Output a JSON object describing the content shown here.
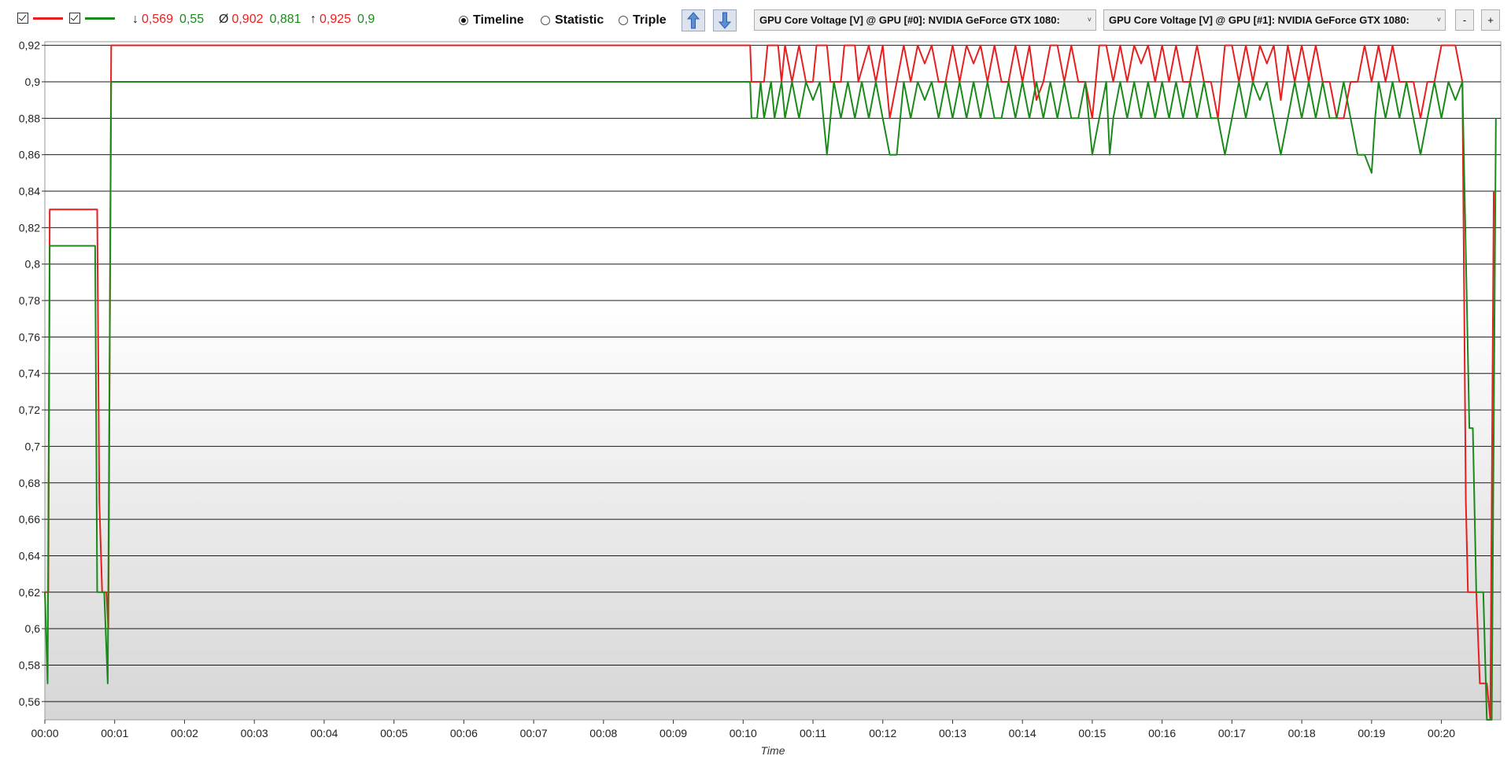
{
  "toolbar": {
    "series_a": {
      "checked": true,
      "color": "#e81f1f"
    },
    "series_b": {
      "checked": true,
      "color": "#1a8a1a"
    },
    "stats": {
      "min_symbol": "↓",
      "min_a": "0,569",
      "min_b": "0,55",
      "avg_symbol": "Ø",
      "avg_a": "0,902",
      "avg_b": "0,881",
      "max_symbol": "↑",
      "max_a": "0,925",
      "max_b": "0,9"
    },
    "modes": [
      {
        "label": "Timeline",
        "selected": true
      },
      {
        "label": "Statistic",
        "selected": false
      },
      {
        "label": "Triple",
        "selected": false
      }
    ],
    "up_icon": "arrow-up-icon",
    "down_icon": "arrow-down-icon",
    "sensor_1": "GPU Core Voltage [V] @ GPU [#0]: NVIDIA GeForce GTX 1080:",
    "sensor_2": "GPU Core Voltage [V] @ GPU [#1]: NVIDIA GeForce GTX 1080:",
    "minus_label": "-",
    "plus_label": "+"
  },
  "chart_data": {
    "type": "line",
    "xlabel": "Time",
    "ylabel": "",
    "ylim": [
      0.55,
      0.922
    ],
    "y_ticks": [
      "0,56",
      "0,58",
      "0,6",
      "0,62",
      "0,64",
      "0,66",
      "0,68",
      "0,7",
      "0,72",
      "0,74",
      "0,76",
      "0,78",
      "0,8",
      "0,82",
      "0,84",
      "0,86",
      "0,88",
      "0,9",
      "0,92"
    ],
    "x_ticks": [
      "00:00",
      "00:01",
      "00:02",
      "00:03",
      "00:04",
      "00:05",
      "00:06",
      "00:07",
      "00:08",
      "00:09",
      "00:10",
      "00:11",
      "00:12",
      "00:13",
      "00:14",
      "00:15",
      "00:16",
      "00:17",
      "00:18",
      "00:19",
      "00:20"
    ],
    "xlim_minutes": [
      0,
      20.85
    ],
    "series": [
      {
        "color": "#e81f1f",
        "points": [
          [
            0.0,
            0.62
          ],
          [
            0.05,
            0.62
          ],
          [
            0.07,
            0.83
          ],
          [
            0.75,
            0.83
          ],
          [
            0.78,
            0.67
          ],
          [
            0.82,
            0.62
          ],
          [
            0.88,
            0.62
          ],
          [
            0.91,
            0.6
          ],
          [
            0.95,
            0.92
          ],
          [
            10.1,
            0.92
          ],
          [
            10.12,
            0.9
          ],
          [
            10.3,
            0.9
          ],
          [
            10.35,
            0.92
          ],
          [
            10.5,
            0.92
          ],
          [
            10.55,
            0.9
          ],
          [
            10.6,
            0.92
          ],
          [
            10.7,
            0.9
          ],
          [
            10.8,
            0.92
          ],
          [
            10.9,
            0.9
          ],
          [
            11.0,
            0.9
          ],
          [
            11.05,
            0.92
          ],
          [
            11.2,
            0.92
          ],
          [
            11.25,
            0.9
          ],
          [
            11.4,
            0.9
          ],
          [
            11.45,
            0.92
          ],
          [
            11.6,
            0.92
          ],
          [
            11.65,
            0.9
          ],
          [
            11.8,
            0.92
          ],
          [
            11.9,
            0.9
          ],
          [
            12.0,
            0.92
          ],
          [
            12.1,
            0.88
          ],
          [
            12.2,
            0.9
          ],
          [
            12.3,
            0.92
          ],
          [
            12.4,
            0.9
          ],
          [
            12.5,
            0.92
          ],
          [
            12.6,
            0.91
          ],
          [
            12.7,
            0.92
          ],
          [
            12.8,
            0.9
          ],
          [
            12.9,
            0.9
          ],
          [
            13.0,
            0.92
          ],
          [
            13.1,
            0.9
          ],
          [
            13.2,
            0.92
          ],
          [
            13.3,
            0.91
          ],
          [
            13.4,
            0.92
          ],
          [
            13.5,
            0.9
          ],
          [
            13.6,
            0.92
          ],
          [
            13.7,
            0.9
          ],
          [
            13.8,
            0.9
          ],
          [
            13.9,
            0.92
          ],
          [
            14.0,
            0.9
          ],
          [
            14.1,
            0.92
          ],
          [
            14.2,
            0.89
          ],
          [
            14.3,
            0.9
          ],
          [
            14.4,
            0.92
          ],
          [
            14.5,
            0.92
          ],
          [
            14.6,
            0.9
          ],
          [
            14.7,
            0.92
          ],
          [
            14.8,
            0.9
          ],
          [
            14.9,
            0.9
          ],
          [
            15.0,
            0.88
          ],
          [
            15.1,
            0.92
          ],
          [
            15.2,
            0.92
          ],
          [
            15.3,
            0.9
          ],
          [
            15.4,
            0.92
          ],
          [
            15.5,
            0.9
          ],
          [
            15.6,
            0.92
          ],
          [
            15.7,
            0.91
          ],
          [
            15.8,
            0.92
          ],
          [
            15.9,
            0.9
          ],
          [
            16.0,
            0.92
          ],
          [
            16.1,
            0.9
          ],
          [
            16.2,
            0.92
          ],
          [
            16.3,
            0.9
          ],
          [
            16.4,
            0.9
          ],
          [
            16.5,
            0.92
          ],
          [
            16.6,
            0.9
          ],
          [
            16.7,
            0.9
          ],
          [
            16.8,
            0.88
          ],
          [
            16.9,
            0.92
          ],
          [
            17.0,
            0.92
          ],
          [
            17.1,
            0.9
          ],
          [
            17.2,
            0.92
          ],
          [
            17.3,
            0.9
          ],
          [
            17.4,
            0.92
          ],
          [
            17.5,
            0.91
          ],
          [
            17.6,
            0.92
          ],
          [
            17.7,
            0.89
          ],
          [
            17.8,
            0.92
          ],
          [
            17.9,
            0.9
          ],
          [
            18.0,
            0.92
          ],
          [
            18.1,
            0.9
          ],
          [
            18.2,
            0.92
          ],
          [
            18.3,
            0.9
          ],
          [
            18.4,
            0.9
          ],
          [
            18.5,
            0.88
          ],
          [
            18.6,
            0.88
          ],
          [
            18.7,
            0.9
          ],
          [
            18.8,
            0.9
          ],
          [
            18.9,
            0.92
          ],
          [
            19.0,
            0.9
          ],
          [
            19.1,
            0.92
          ],
          [
            19.2,
            0.9
          ],
          [
            19.3,
            0.92
          ],
          [
            19.4,
            0.9
          ],
          [
            19.5,
            0.9
          ],
          [
            19.6,
            0.9
          ],
          [
            19.7,
            0.88
          ],
          [
            19.8,
            0.9
          ],
          [
            19.9,
            0.9
          ],
          [
            20.0,
            0.92
          ],
          [
            20.1,
            0.92
          ],
          [
            20.2,
            0.92
          ],
          [
            20.3,
            0.9
          ],
          [
            20.35,
            0.67
          ],
          [
            20.38,
            0.62
          ],
          [
            20.5,
            0.62
          ],
          [
            20.55,
            0.57
          ],
          [
            20.65,
            0.57
          ],
          [
            20.7,
            0.55
          ],
          [
            20.75,
            0.84
          ]
        ]
      },
      {
        "color": "#1a8a1a",
        "points": [
          [
            0.0,
            0.62
          ],
          [
            0.04,
            0.57
          ],
          [
            0.07,
            0.81
          ],
          [
            0.72,
            0.81
          ],
          [
            0.75,
            0.62
          ],
          [
            0.85,
            0.62
          ],
          [
            0.9,
            0.57
          ],
          [
            0.95,
            0.9
          ],
          [
            10.1,
            0.9
          ],
          [
            10.12,
            0.88
          ],
          [
            10.2,
            0.88
          ],
          [
            10.25,
            0.9
          ],
          [
            10.3,
            0.88
          ],
          [
            10.4,
            0.9
          ],
          [
            10.45,
            0.88
          ],
          [
            10.55,
            0.9
          ],
          [
            10.6,
            0.88
          ],
          [
            10.7,
            0.9
          ],
          [
            10.8,
            0.88
          ],
          [
            10.9,
            0.9
          ],
          [
            11.0,
            0.89
          ],
          [
            11.1,
            0.9
          ],
          [
            11.15,
            0.88
          ],
          [
            11.2,
            0.86
          ],
          [
            11.25,
            0.88
          ],
          [
            11.3,
            0.9
          ],
          [
            11.4,
            0.88
          ],
          [
            11.5,
            0.9
          ],
          [
            11.6,
            0.88
          ],
          [
            11.7,
            0.9
          ],
          [
            11.8,
            0.88
          ],
          [
            11.9,
            0.9
          ],
          [
            12.0,
            0.88
          ],
          [
            12.1,
            0.86
          ],
          [
            12.2,
            0.86
          ],
          [
            12.3,
            0.9
          ],
          [
            12.4,
            0.88
          ],
          [
            12.5,
            0.9
          ],
          [
            12.6,
            0.89
          ],
          [
            12.7,
            0.9
          ],
          [
            12.8,
            0.88
          ],
          [
            12.9,
            0.9
          ],
          [
            13.0,
            0.88
          ],
          [
            13.1,
            0.9
          ],
          [
            13.2,
            0.88
          ],
          [
            13.3,
            0.9
          ],
          [
            13.4,
            0.88
          ],
          [
            13.5,
            0.9
          ],
          [
            13.6,
            0.88
          ],
          [
            13.7,
            0.88
          ],
          [
            13.8,
            0.9
          ],
          [
            13.9,
            0.88
          ],
          [
            14.0,
            0.9
          ],
          [
            14.1,
            0.88
          ],
          [
            14.2,
            0.9
          ],
          [
            14.3,
            0.88
          ],
          [
            14.4,
            0.9
          ],
          [
            14.5,
            0.88
          ],
          [
            14.6,
            0.9
          ],
          [
            14.7,
            0.88
          ],
          [
            14.8,
            0.88
          ],
          [
            14.9,
            0.9
          ],
          [
            15.0,
            0.86
          ],
          [
            15.1,
            0.88
          ],
          [
            15.2,
            0.9
          ],
          [
            15.25,
            0.86
          ],
          [
            15.3,
            0.88
          ],
          [
            15.4,
            0.9
          ],
          [
            15.5,
            0.88
          ],
          [
            15.6,
            0.9
          ],
          [
            15.7,
            0.88
          ],
          [
            15.8,
            0.9
          ],
          [
            15.9,
            0.88
          ],
          [
            16.0,
            0.9
          ],
          [
            16.1,
            0.88
          ],
          [
            16.2,
            0.9
          ],
          [
            16.3,
            0.88
          ],
          [
            16.4,
            0.9
          ],
          [
            16.5,
            0.88
          ],
          [
            16.6,
            0.9
          ],
          [
            16.7,
            0.88
          ],
          [
            16.8,
            0.88
          ],
          [
            16.9,
            0.86
          ],
          [
            17.0,
            0.88
          ],
          [
            17.1,
            0.9
          ],
          [
            17.2,
            0.88
          ],
          [
            17.3,
            0.9
          ],
          [
            17.4,
            0.89
          ],
          [
            17.5,
            0.9
          ],
          [
            17.6,
            0.88
          ],
          [
            17.7,
            0.86
          ],
          [
            17.8,
            0.88
          ],
          [
            17.9,
            0.9
          ],
          [
            18.0,
            0.88
          ],
          [
            18.1,
            0.9
          ],
          [
            18.2,
            0.88
          ],
          [
            18.3,
            0.9
          ],
          [
            18.4,
            0.88
          ],
          [
            18.5,
            0.88
          ],
          [
            18.6,
            0.9
          ],
          [
            18.7,
            0.88
          ],
          [
            18.8,
            0.86
          ],
          [
            18.9,
            0.86
          ],
          [
            19.0,
            0.85
          ],
          [
            19.05,
            0.88
          ],
          [
            19.1,
            0.9
          ],
          [
            19.2,
            0.88
          ],
          [
            19.3,
            0.9
          ],
          [
            19.4,
            0.88
          ],
          [
            19.5,
            0.9
          ],
          [
            19.6,
            0.88
          ],
          [
            19.7,
            0.86
          ],
          [
            19.8,
            0.88
          ],
          [
            19.9,
            0.9
          ],
          [
            20.0,
            0.88
          ],
          [
            20.1,
            0.9
          ],
          [
            20.2,
            0.89
          ],
          [
            20.3,
            0.9
          ],
          [
            20.4,
            0.71
          ],
          [
            20.45,
            0.71
          ],
          [
            20.5,
            0.62
          ],
          [
            20.6,
            0.62
          ],
          [
            20.65,
            0.55
          ],
          [
            20.72,
            0.55
          ],
          [
            20.78,
            0.88
          ]
        ]
      }
    ]
  }
}
